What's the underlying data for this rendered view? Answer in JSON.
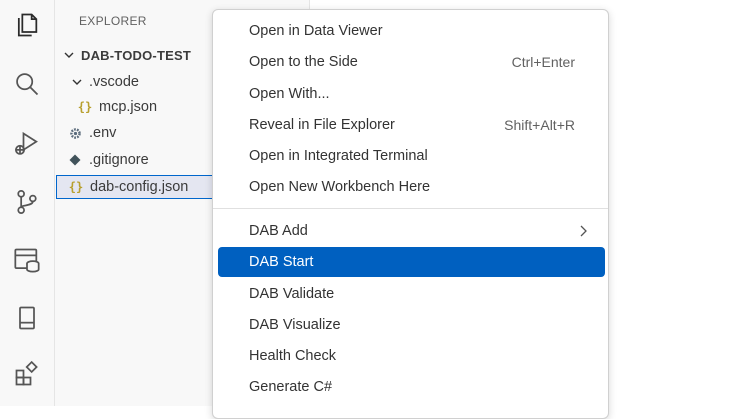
{
  "activity_bar": {
    "icons": [
      "files-icon",
      "search-icon",
      "run-debug-icon",
      "source-control-icon",
      "database-icon",
      "panel-icon",
      "extensions-icon"
    ]
  },
  "sidebar": {
    "title": "EXPLORER",
    "root_folder": "DAB-TODO-TEST",
    "items": [
      {
        "label": ".vscode"
      },
      {
        "label": "mcp.json"
      },
      {
        "label": ".env"
      },
      {
        "label": ".gitignore"
      },
      {
        "label": "dab-config.json"
      }
    ]
  },
  "context_menu": {
    "group1": [
      {
        "label": "Open in Data Viewer",
        "shortcut": ""
      },
      {
        "label": "Open to the Side",
        "shortcut": "Ctrl+Enter"
      },
      {
        "label": "Open With...",
        "shortcut": ""
      },
      {
        "label": "Reveal in File Explorer",
        "shortcut": "Shift+Alt+R"
      },
      {
        "label": "Open in Integrated Terminal",
        "shortcut": ""
      },
      {
        "label": "Open New Workbench Here",
        "shortcut": ""
      }
    ],
    "group2": [
      {
        "label": "DAB Add",
        "has_submenu": true
      },
      {
        "label": "DAB Start",
        "active": true
      },
      {
        "label": "DAB Validate"
      },
      {
        "label": "DAB Visualize"
      },
      {
        "label": "Health Check"
      },
      {
        "label": "Generate C#"
      }
    ]
  },
  "colors": {
    "accent": "#0060c0",
    "json_icon": "#b8a02f",
    "selection_border": "#0066cc"
  }
}
